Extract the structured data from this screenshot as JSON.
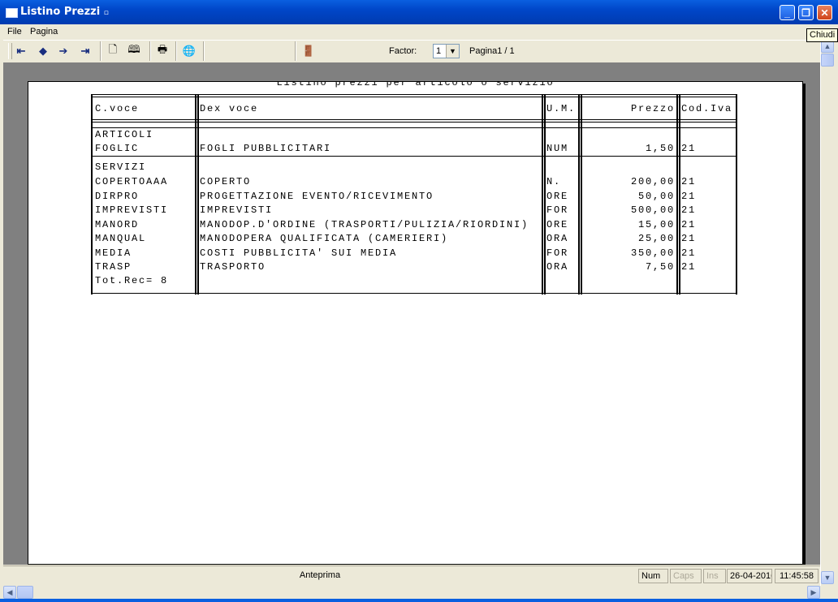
{
  "window": {
    "title": "Listino Prezzi",
    "title_marker": "▫",
    "buttons": {
      "minimize": "_",
      "restore": "❐",
      "close": "✕"
    }
  },
  "tooltip": "Chiudi",
  "menu": [
    {
      "label": "File"
    },
    {
      "label": "Pagina"
    }
  ],
  "toolbar": {
    "buttons": [
      {
        "name": "first-page-button",
        "icon": "first-page-icon",
        "glyph": "⇤"
      },
      {
        "name": "prev-page-button",
        "icon": "arrow-left-icon",
        "glyph": "◆"
      },
      {
        "name": "next-page-button",
        "icon": "arrow-right-icon",
        "glyph": "➔"
      },
      {
        "name": "last-page-button",
        "icon": "last-page-icon",
        "glyph": "⇥"
      },
      {
        "name": "single-page-button",
        "icon": "page-icon",
        "glyph": "🗋"
      },
      {
        "name": "two-pages-button",
        "icon": "book-icon",
        "glyph": "🕮"
      },
      {
        "name": "print-button",
        "icon": "printer-icon",
        "glyph": "🖶"
      },
      {
        "name": "export-button",
        "icon": "globe-icon",
        "glyph": "🌐"
      },
      {
        "name": "exit-button",
        "icon": "door-exit-icon",
        "glyph": "🚪"
      }
    ],
    "factor_label": "Factor:",
    "factor_value": "1",
    "page_label": "Pagina1 / 1"
  },
  "report": {
    "title": "Listino prezzi per articolo o servizio",
    "headers": {
      "code": "C.voce",
      "desc": "Dex voce",
      "um": "U.M.",
      "price": "Prezzo",
      "vat": "Cod.Iva"
    },
    "groups": [
      {
        "name": "ARTICOLI",
        "rows": [
          {
            "code": "FOGLIC",
            "desc": "FOGLI PUBBLICITARI",
            "um": "NUM",
            "price": "1,50",
            "vat": "21"
          }
        ]
      },
      {
        "name": "SERVIZI",
        "rows": [
          {
            "code": "COPERTOAAA",
            "desc": "COPERTO",
            "um": "N.",
            "price": "200,00",
            "vat": "21"
          },
          {
            "code": "DIRPRO",
            "desc": "PROGETTAZIONE EVENTO/RICEVIMENTO",
            "um": "ORE",
            "price": "50,00",
            "vat": "21"
          },
          {
            "code": "IMPREVISTI",
            "desc": "IMPREVISTI",
            "um": "FOR",
            "price": "500,00",
            "vat": "21"
          },
          {
            "code": "MANORD",
            "desc": "MANODOP.D'ORDINE (TRASPORTI/PULIZIA/RIORDINI)",
            "um": "ORE",
            "price": "15,00",
            "vat": "21"
          },
          {
            "code": "MANQUAL",
            "desc": "MANODOPERA QUALIFICATA (CAMERIERI)",
            "um": "ORA",
            "price": "25,00",
            "vat": "21"
          },
          {
            "code": "MEDIA",
            "desc": "COSTI PUBBLICITA' SUI MEDIA",
            "um": "FOR",
            "price": "350,00",
            "vat": "21"
          },
          {
            "code": "TRASP",
            "desc": "TRASPORTO",
            "um": "ORA",
            "price": "7,50",
            "vat": "21"
          }
        ]
      }
    ],
    "total": "Tot.Rec= 8"
  },
  "status": {
    "mode": "Anteprima",
    "num": "Num",
    "caps": "Caps",
    "ins": "Ins",
    "date": "26-04-2016",
    "time": "11:45:58"
  }
}
